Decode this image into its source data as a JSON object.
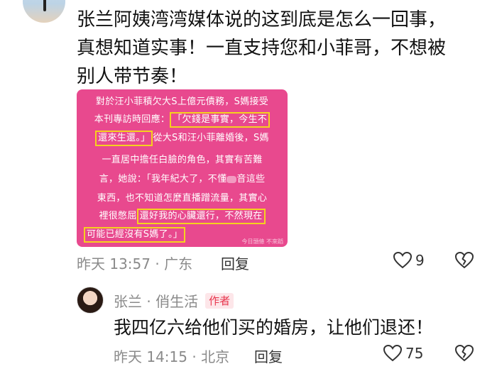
{
  "comment1": {
    "lines": [
      "张兰阿姨湾湾媒体说的这到底是怎么一回事，",
      "真想知道实事！一直支持您和小菲哥，不想被",
      "别人带节奏！"
    ],
    "time": "昨天 13:57 · 广东",
    "reply_label": "回复",
    "like_count": "9"
  },
  "news_image": {
    "l1": "對於汪小菲積欠大S上億元債務，S媽接受",
    "l2": "本刊專訪時回應：",
    "l2_hl": "「欠錢是事實，今生不",
    "l3_hl": "還來生還。」",
    "l3": "從大S和汪小菲離婚後，S媽",
    "l4": "一直居中擔任白臉的角色，其實有苦難",
    "l5a": "言，她說：「我年紀大了，不懂",
    "l5b": "音這些",
    "l6": "東西，也不知道怎麼直播蹭流量，其實心",
    "l7": "裡很憋屈",
    "l7_hl": "還好我的心臟還行，不然現在",
    "l8_hl": "可能已經沒有S媽了。」",
    "watermark": "今日頭條 不來蹈"
  },
  "comment2": {
    "author": "张兰 · 俏生活",
    "badge": "作者",
    "text": "我四亿六给他们买的婚房，让他们退还！",
    "time": "昨天 14:15 · 北京",
    "reply_label": "回复",
    "like_count": "75"
  },
  "icons": {
    "like": "heart-outline-icon",
    "dislike": "broken-heart-icon"
  }
}
